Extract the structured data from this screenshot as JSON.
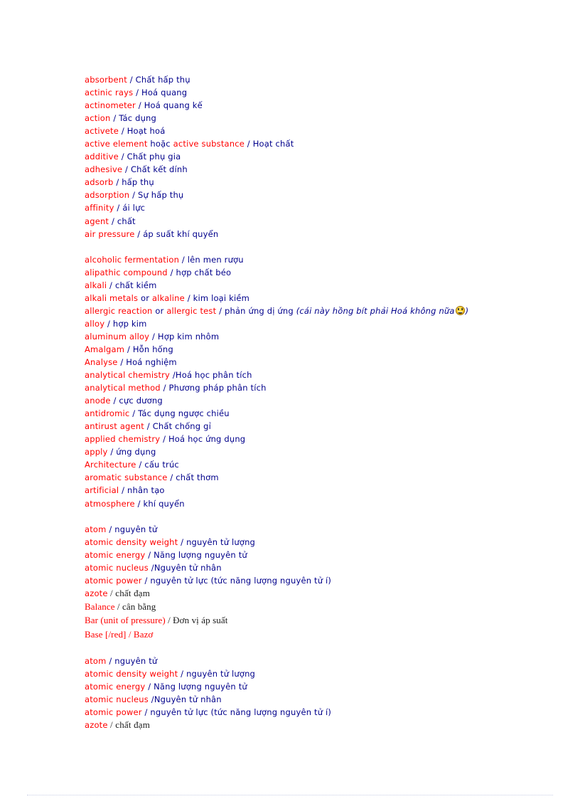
{
  "document": {
    "type": "chemistry-english-vietnamese-glossary",
    "colors": {
      "english_term": "#ff0000",
      "vietnamese_gloss": "#00008b",
      "serif_gloss": "#1a1a1a",
      "page_background": "#ffffff",
      "footer_rule": "#c9cfe6"
    }
  },
  "groups": [
    {
      "id": "group-a-1",
      "entries": [
        {
          "en": "absorbent",
          "sep": " / ",
          "vi": "Chất hấp thụ"
        },
        {
          "en": "actinic rays",
          "sep": " / ",
          "vi": "Hoá quang"
        },
        {
          "en": "actinometer",
          "sep": " / ",
          "vi": "Hoá quang kế"
        },
        {
          "en": "action",
          "sep": " / ",
          "vi": "Tác dụng"
        },
        {
          "en": "activete",
          "sep": " / ",
          "vi": "Hoạt hoá"
        },
        {
          "en": "active element",
          "conj": " hoặc ",
          "en2": "active substance",
          "sep": " / ",
          "vi": "Hoạt chất"
        },
        {
          "en": "additive",
          "sep": " / ",
          "vi": "Chất phụ gia"
        },
        {
          "en": "adhesive",
          "sep": " / ",
          "vi": "Chất kết dính"
        },
        {
          "en": "adsorb",
          "sep": " / ",
          "vi": "hấp thụ"
        },
        {
          "en": "adsorption",
          "sep": " / ",
          "vi": "Sự hấp thụ"
        },
        {
          "en": "affinity",
          "sep": " / ",
          "vi": "ái lực"
        },
        {
          "en": "agent",
          "sep": " / ",
          "vi": "chất"
        },
        {
          "en": "air pressure",
          "sep": " / ",
          "vi": "áp suất khí quyển"
        }
      ]
    },
    {
      "id": "group-a-2",
      "entries": [
        {
          "en": "alcoholic fermentation",
          "sep": " / ",
          "vi": "lên men rượu"
        },
        {
          "en": "alipathic compound",
          "sep": " / ",
          "vi": "hợp chất béo"
        },
        {
          "en": "alkali",
          "sep": " / ",
          "vi": "chất kiềm"
        },
        {
          "en": "alkali metals",
          "conj": " or ",
          "en2": "alkaline",
          "sep": " / ",
          "vi": "kim loại kiềm"
        },
        {
          "en": "allergic reaction",
          "conj": " or ",
          "en2": "allergic test",
          "sep": " / ",
          "vi": "phản ứng dị ứng ",
          "note": "(cái này hồng bít phải Hoá không nữa",
          "emoji": "grinning-face",
          "note_tail": ")"
        },
        {
          "en": "alloy",
          "sep": " / ",
          "vi": "hợp kim"
        },
        {
          "en": "aluminum  alloy",
          "sep": " / ",
          "vi": "Hợp kim nhôm"
        },
        {
          "en": "Amalgam",
          "sep": " / ",
          "vi": "Hỗn hống"
        },
        {
          "en": "Analyse",
          "sep": " / ",
          "vi": "Hoá nghiệm"
        },
        {
          "en": "analytical chemistry",
          "sep": " /",
          "vi": "Hoá học phân tích"
        },
        {
          "en": "analytical method",
          "sep": " / ",
          "vi": "Phương pháp phân tích"
        },
        {
          "en": "anode",
          "sep": " / ",
          "vi": "cực dương"
        },
        {
          "en": "antidromic",
          "sep": " / ",
          "vi": "Tác dụng ngược chiều"
        },
        {
          "en": "antirust agent",
          "sep": " / ",
          "vi": "Chất chống gỉ"
        },
        {
          "en": "applied chemistry",
          "sep": " / ",
          "vi": "Hoá học ứng dụng"
        },
        {
          "en": "apply",
          "sep": " / ",
          "vi": "ứng dụng"
        },
        {
          "en": "Architecture",
          "sep": " / ",
          "vi": "cấu trúc"
        },
        {
          "en": "aromatic substance",
          "sep": " / ",
          "vi": "chất thơm"
        },
        {
          "en": "artificial",
          "sep": " / ",
          "vi": "nhân tạo"
        },
        {
          "en": "atmosphere",
          "sep": " / ",
          "vi": "khí quyển"
        }
      ]
    },
    {
      "id": "group-atom-1",
      "entries": [
        {
          "en": "atom",
          "sep": " / ",
          "vi": "nguyên tử"
        },
        {
          "en": "atomic density weight",
          "sep": " / ",
          "vi": "nguyên tử lượng"
        },
        {
          "en": "atomic energy",
          "sep": " / ",
          "vi": "Năng lượng nguyên tử"
        },
        {
          "en": "atomic nucleus",
          "sep": " /",
          "vi": "Nguyên tử nhân"
        },
        {
          "en": "atomic power",
          "sep": " / ",
          "vi": "nguyên tử lực (tức năng lượng nguyên tử í)"
        },
        {
          "en": "azote",
          "sep": " / ",
          "vi": "chất đạm",
          "style": "mixed"
        },
        {
          "en": "Balance",
          "sep": " / ",
          "vi": "cân bằng",
          "style": "serif"
        },
        {
          "en": "Bar (unit of pressure)",
          "sep": " / ",
          "vi": "Đơn vị áp suất",
          "style": "serif"
        },
        {
          "en": "Base [/red]",
          "sep": " / ",
          "vi": "Bazơ",
          "style": "serif-all-red"
        }
      ]
    },
    {
      "id": "group-atom-2",
      "entries": [
        {
          "en": "atom",
          "sep": " / ",
          "vi": "nguyên tử"
        },
        {
          "en": "atomic density weight",
          "sep": " / ",
          "vi": "nguyên tử lượng"
        },
        {
          "en": "atomic energy",
          "sep": " / ",
          "vi": "Năng lượng nguyên tử"
        },
        {
          "en": "atomic nucleus",
          "sep": " /",
          "vi": "Nguyên tử nhân"
        },
        {
          "en": "atomic power",
          "sep": " / ",
          "vi": "nguyên tử lực (tức năng lượng nguyên tử í)"
        },
        {
          "en": "azote",
          "sep": " / ",
          "vi": "chất đạm",
          "style": "mixed"
        }
      ]
    }
  ]
}
